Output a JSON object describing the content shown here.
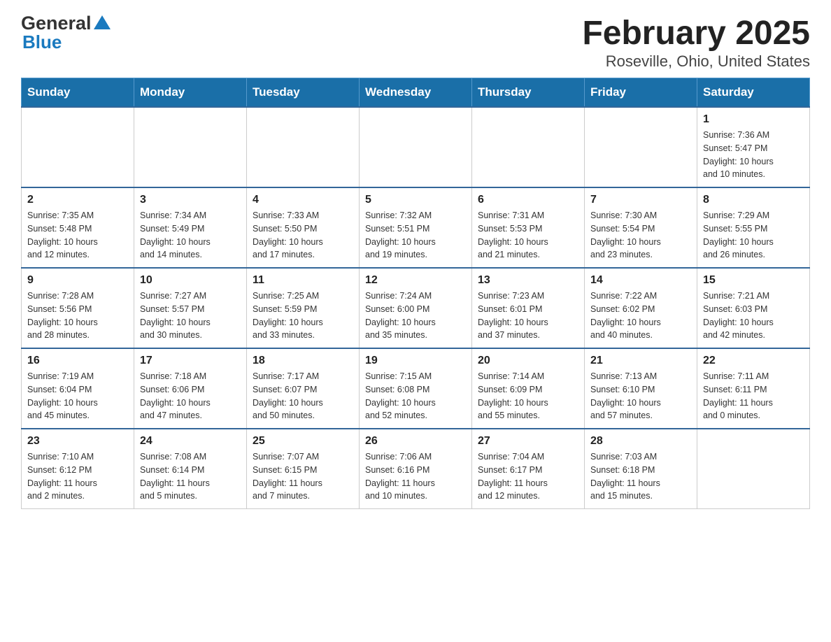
{
  "logo": {
    "text_general": "General",
    "text_blue": "Blue"
  },
  "title": "February 2025",
  "subtitle": "Roseville, Ohio, United States",
  "days_of_week": [
    "Sunday",
    "Monday",
    "Tuesday",
    "Wednesday",
    "Thursday",
    "Friday",
    "Saturday"
  ],
  "weeks": [
    {
      "days": [
        {
          "num": "",
          "info": ""
        },
        {
          "num": "",
          "info": ""
        },
        {
          "num": "",
          "info": ""
        },
        {
          "num": "",
          "info": ""
        },
        {
          "num": "",
          "info": ""
        },
        {
          "num": "",
          "info": ""
        },
        {
          "num": "1",
          "info": "Sunrise: 7:36 AM\nSunset: 5:47 PM\nDaylight: 10 hours\nand 10 minutes."
        }
      ]
    },
    {
      "days": [
        {
          "num": "2",
          "info": "Sunrise: 7:35 AM\nSunset: 5:48 PM\nDaylight: 10 hours\nand 12 minutes."
        },
        {
          "num": "3",
          "info": "Sunrise: 7:34 AM\nSunset: 5:49 PM\nDaylight: 10 hours\nand 14 minutes."
        },
        {
          "num": "4",
          "info": "Sunrise: 7:33 AM\nSunset: 5:50 PM\nDaylight: 10 hours\nand 17 minutes."
        },
        {
          "num": "5",
          "info": "Sunrise: 7:32 AM\nSunset: 5:51 PM\nDaylight: 10 hours\nand 19 minutes."
        },
        {
          "num": "6",
          "info": "Sunrise: 7:31 AM\nSunset: 5:53 PM\nDaylight: 10 hours\nand 21 minutes."
        },
        {
          "num": "7",
          "info": "Sunrise: 7:30 AM\nSunset: 5:54 PM\nDaylight: 10 hours\nand 23 minutes."
        },
        {
          "num": "8",
          "info": "Sunrise: 7:29 AM\nSunset: 5:55 PM\nDaylight: 10 hours\nand 26 minutes."
        }
      ]
    },
    {
      "days": [
        {
          "num": "9",
          "info": "Sunrise: 7:28 AM\nSunset: 5:56 PM\nDaylight: 10 hours\nand 28 minutes."
        },
        {
          "num": "10",
          "info": "Sunrise: 7:27 AM\nSunset: 5:57 PM\nDaylight: 10 hours\nand 30 minutes."
        },
        {
          "num": "11",
          "info": "Sunrise: 7:25 AM\nSunset: 5:59 PM\nDaylight: 10 hours\nand 33 minutes."
        },
        {
          "num": "12",
          "info": "Sunrise: 7:24 AM\nSunset: 6:00 PM\nDaylight: 10 hours\nand 35 minutes."
        },
        {
          "num": "13",
          "info": "Sunrise: 7:23 AM\nSunset: 6:01 PM\nDaylight: 10 hours\nand 37 minutes."
        },
        {
          "num": "14",
          "info": "Sunrise: 7:22 AM\nSunset: 6:02 PM\nDaylight: 10 hours\nand 40 minutes."
        },
        {
          "num": "15",
          "info": "Sunrise: 7:21 AM\nSunset: 6:03 PM\nDaylight: 10 hours\nand 42 minutes."
        }
      ]
    },
    {
      "days": [
        {
          "num": "16",
          "info": "Sunrise: 7:19 AM\nSunset: 6:04 PM\nDaylight: 10 hours\nand 45 minutes."
        },
        {
          "num": "17",
          "info": "Sunrise: 7:18 AM\nSunset: 6:06 PM\nDaylight: 10 hours\nand 47 minutes."
        },
        {
          "num": "18",
          "info": "Sunrise: 7:17 AM\nSunset: 6:07 PM\nDaylight: 10 hours\nand 50 minutes."
        },
        {
          "num": "19",
          "info": "Sunrise: 7:15 AM\nSunset: 6:08 PM\nDaylight: 10 hours\nand 52 minutes."
        },
        {
          "num": "20",
          "info": "Sunrise: 7:14 AM\nSunset: 6:09 PM\nDaylight: 10 hours\nand 55 minutes."
        },
        {
          "num": "21",
          "info": "Sunrise: 7:13 AM\nSunset: 6:10 PM\nDaylight: 10 hours\nand 57 minutes."
        },
        {
          "num": "22",
          "info": "Sunrise: 7:11 AM\nSunset: 6:11 PM\nDaylight: 11 hours\nand 0 minutes."
        }
      ]
    },
    {
      "days": [
        {
          "num": "23",
          "info": "Sunrise: 7:10 AM\nSunset: 6:12 PM\nDaylight: 11 hours\nand 2 minutes."
        },
        {
          "num": "24",
          "info": "Sunrise: 7:08 AM\nSunset: 6:14 PM\nDaylight: 11 hours\nand 5 minutes."
        },
        {
          "num": "25",
          "info": "Sunrise: 7:07 AM\nSunset: 6:15 PM\nDaylight: 11 hours\nand 7 minutes."
        },
        {
          "num": "26",
          "info": "Sunrise: 7:06 AM\nSunset: 6:16 PM\nDaylight: 11 hours\nand 10 minutes."
        },
        {
          "num": "27",
          "info": "Sunrise: 7:04 AM\nSunset: 6:17 PM\nDaylight: 11 hours\nand 12 minutes."
        },
        {
          "num": "28",
          "info": "Sunrise: 7:03 AM\nSunset: 6:18 PM\nDaylight: 11 hours\nand 15 minutes."
        },
        {
          "num": "",
          "info": ""
        }
      ]
    }
  ]
}
